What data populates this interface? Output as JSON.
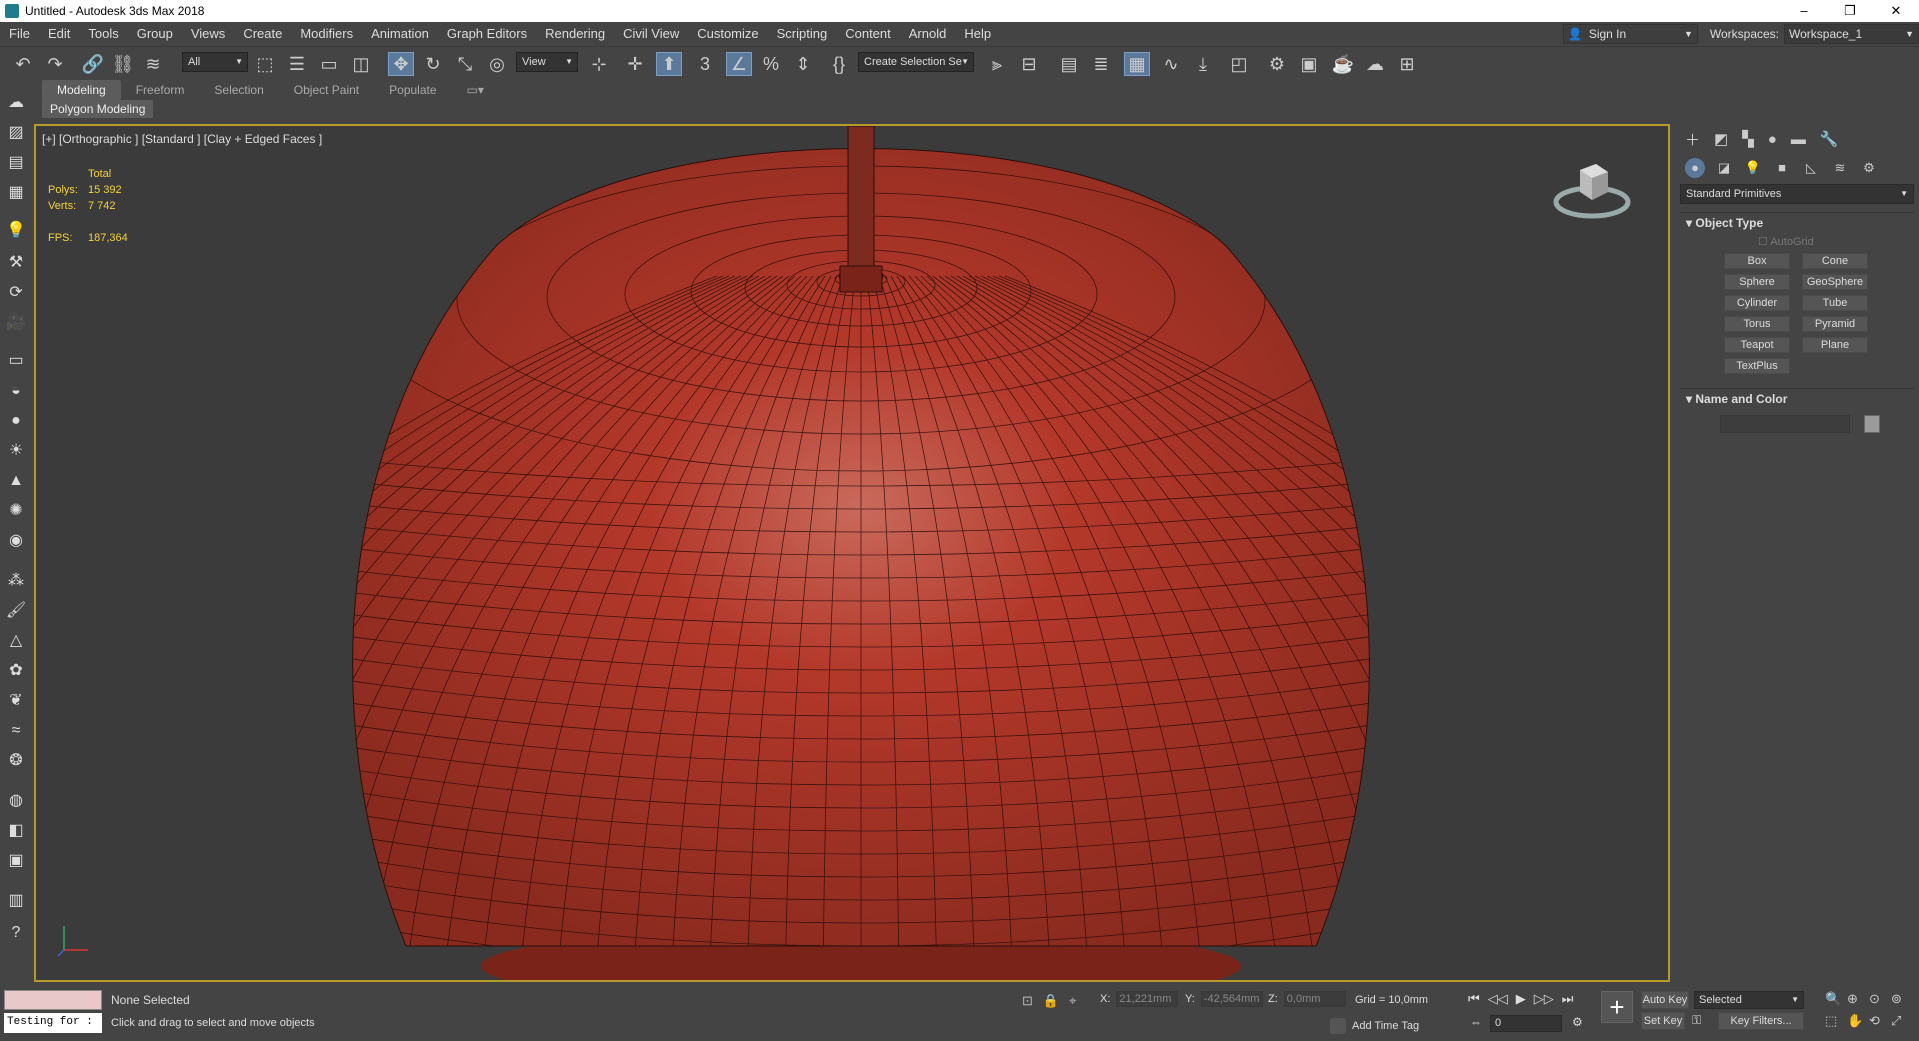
{
  "window": {
    "title": "Untitled - Autodesk 3ds Max 2018",
    "minimize": "–",
    "maximize": "❐",
    "close": "✕"
  },
  "menu": [
    "File",
    "Edit",
    "Tools",
    "Group",
    "Views",
    "Create",
    "Modifiers",
    "Animation",
    "Graph Editors",
    "Rendering",
    "Civil View",
    "Customize",
    "Scripting",
    "Content",
    "Arnold",
    "Help"
  ],
  "account": {
    "sign_in": "Sign In",
    "workspaces_label": "Workspaces:",
    "workspace": "Workspace_1"
  },
  "toolbar": {
    "filter": "All",
    "ref_coord": "View",
    "named_selection": "Create Selection Se"
  },
  "ribbon": {
    "tabs": [
      "Modeling",
      "Freeform",
      "Selection",
      "Object Paint",
      "Populate"
    ],
    "active_panel": "Polygon Modeling"
  },
  "viewport": {
    "label": "[+] [Orthographic ] [Standard ] [Clay + Edged Faces ]",
    "stats_header": "Total",
    "polys_label": "Polys:",
    "polys": "15 392",
    "verts_label": "Verts:",
    "verts": "7 742",
    "fps_label": "FPS:",
    "fps": "187,364",
    "object_color": "#b3382a"
  },
  "command_panel": {
    "category": "Standard Primitives",
    "object_type_title": "Object Type",
    "autogrid": "AutoGrid",
    "primitives": [
      "Box",
      "Cone",
      "Sphere",
      "GeoSphere",
      "Cylinder",
      "Tube",
      "Torus",
      "Pyramid",
      "Teapot",
      "Plane",
      "TextPlus"
    ],
    "name_color_title": "Name and Color"
  },
  "status": {
    "command_text": "Testing for :",
    "selection": "None Selected",
    "hint": "Click and drag to select and move objects",
    "x_label": "X:",
    "x": "21,221mm",
    "y_label": "Y:",
    "y": "-42,564mm",
    "z_label": "Z:",
    "z": "0,0mm",
    "grid": "Grid = 10,0mm",
    "add_time_tag": "Add Time Tag",
    "frame": "0",
    "auto_key": "Auto Key",
    "set_key": "Set Key",
    "key_mode": "Selected",
    "key_filters": "Key Filters..."
  }
}
